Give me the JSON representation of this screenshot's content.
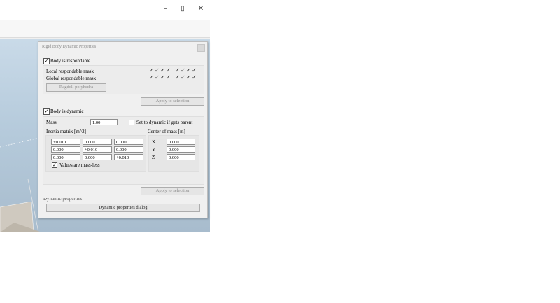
{
  "window_controls": {
    "minimize": "–",
    "restore": "▯",
    "close": "✕"
  },
  "dialog": {
    "title": "Rigid Body Dynamic Properties",
    "body_is_responsible": {
      "label": "Body is respondable",
      "checked": true
    },
    "local_mask_label": "Local respondable mask",
    "global_mask_label": "Global respondable mask",
    "mask_tick": "✓",
    "ragdoll_button": "Ragdoll polyhedra",
    "apply_button_1": "Apply to selection",
    "body_is_dynamic": {
      "label": "Body is dynamic",
      "checked": true
    },
    "mass_label": "Mass",
    "mass_value": "1.00",
    "set_dynamic_label": "Set to dynamic if gets parent",
    "inertia_label": "Inertia matrix [m^2]",
    "inertia_values": [
      [
        "+0.010",
        "0.000",
        "0.000"
      ],
      [
        "0.000",
        "+0.010",
        "0.000"
      ],
      [
        "0.000",
        "0.000",
        "+0.010"
      ]
    ],
    "values_mass_less": {
      "label": "Values are mass-less",
      "checked": true
    },
    "com_label": "Center of mass [m]",
    "com_axes": [
      "X",
      "Y",
      "Z"
    ],
    "com_values": [
      "0.000",
      "0.000",
      "0.000"
    ],
    "apply_button_2": "Apply to selection",
    "dynamic_props_section": "Dynamic properties",
    "dynamic_props_button": "Dynamic properties dialog"
  }
}
